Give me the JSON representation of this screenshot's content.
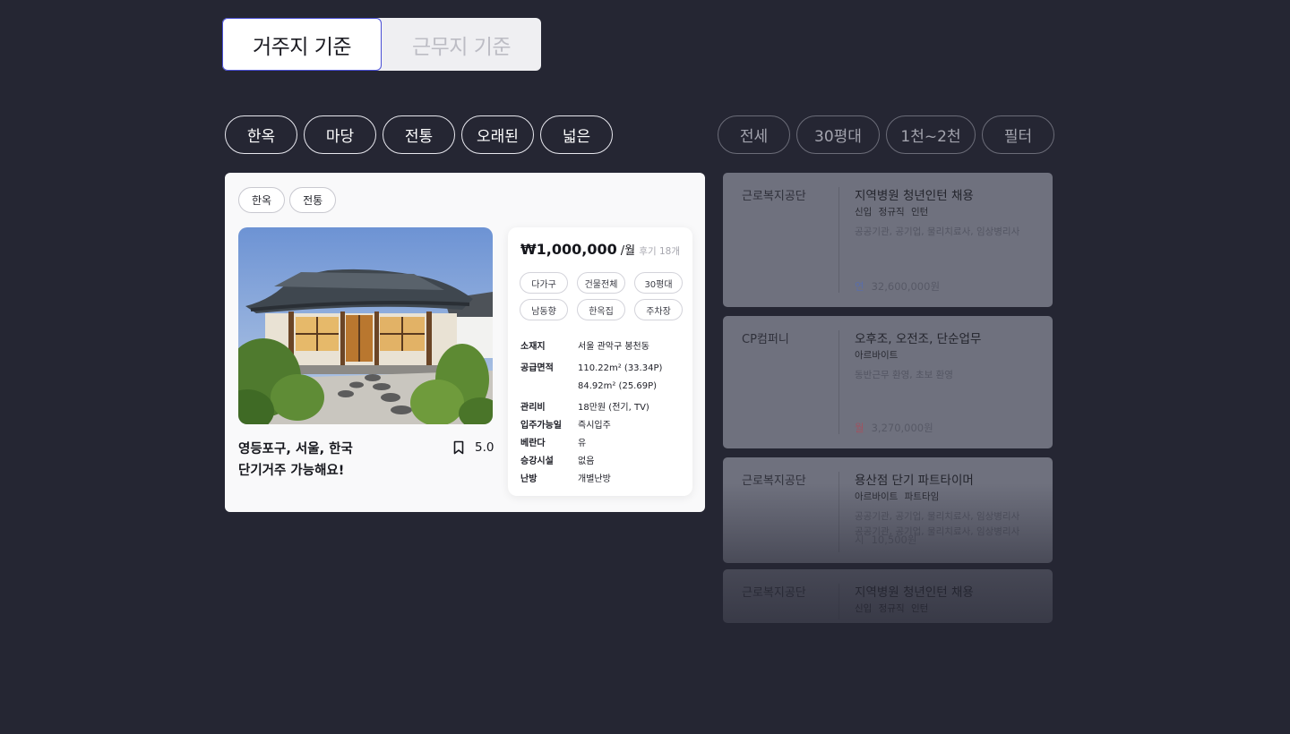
{
  "mode_toggle": {
    "residence_label": "거주지 기준",
    "work_label": "근무지 기준"
  },
  "house_chips": [
    "한옥",
    "마당",
    "전통",
    "오래된",
    "넓은"
  ],
  "job_chips": [
    "전세",
    "30평대",
    "1천~2천",
    "필터"
  ],
  "listing": {
    "tags": [
      "한옥",
      "전통"
    ],
    "title_line1": "영등포구, 서울, 한국",
    "title_line2": "단기거주 가능해요!",
    "rating": "5.0",
    "price": "₩1,000,000",
    "price_unit": "/월",
    "reviews": "후기 18개",
    "features": [
      "다가구",
      "건물전체",
      "30평대",
      "남동향",
      "한옥집",
      "주차장"
    ],
    "info": {
      "location_label": "소재지",
      "location": "서울 관악구 봉천동",
      "area_label": "공급면적",
      "area1": "110.22m² (33.34P)",
      "area2": "84.92m² (25.69P)",
      "fee_label": "관리비",
      "fee": "18만원 (전기, TV)",
      "movein_label": "입주가능일",
      "movein": "즉시입주",
      "balcony_label": "베란다",
      "balcony": "유",
      "elevator_label": "승강시설",
      "elevator": "없음",
      "heating_label": "난방",
      "heating": "개별난방"
    }
  },
  "jobs": [
    {
      "company": "근로복지공단",
      "title": "지역병원 청년인턴 채용",
      "meta": "신입 정규직 인턴",
      "desc": "공공기관, 공기업, 물리치료사, 임상병리사",
      "pay_kind": "연",
      "pay": "32,600,000원"
    },
    {
      "company": "CP컴퍼니",
      "title": "오후조, 오전조, 단순업무",
      "meta": "아르바이트",
      "desc": "동반근무 환영, 초보 환영",
      "pay_kind": "월",
      "pay": "3,270,000원"
    },
    {
      "company": "근로복지공단",
      "title": "용산점 단기 파트타이머",
      "meta": "아르바이트 파트타임",
      "desc": "공공기관, 공기업, 물리치료사, 임상병리사",
      "desc2": "공공기관, 공기업, 물리치료사, 임상병리사",
      "pay_kind": "시",
      "pay": "10,500원"
    },
    {
      "company": "근로복지공단",
      "title": "지역병원 청년인턴 채용",
      "meta": "신입 정규직 인턴"
    }
  ],
  "colors": {
    "background": "#252633",
    "accent_border": "#4a4fd6",
    "job_card": "#6f717e"
  },
  "icons": {
    "bookmark": "bookmark-icon"
  }
}
